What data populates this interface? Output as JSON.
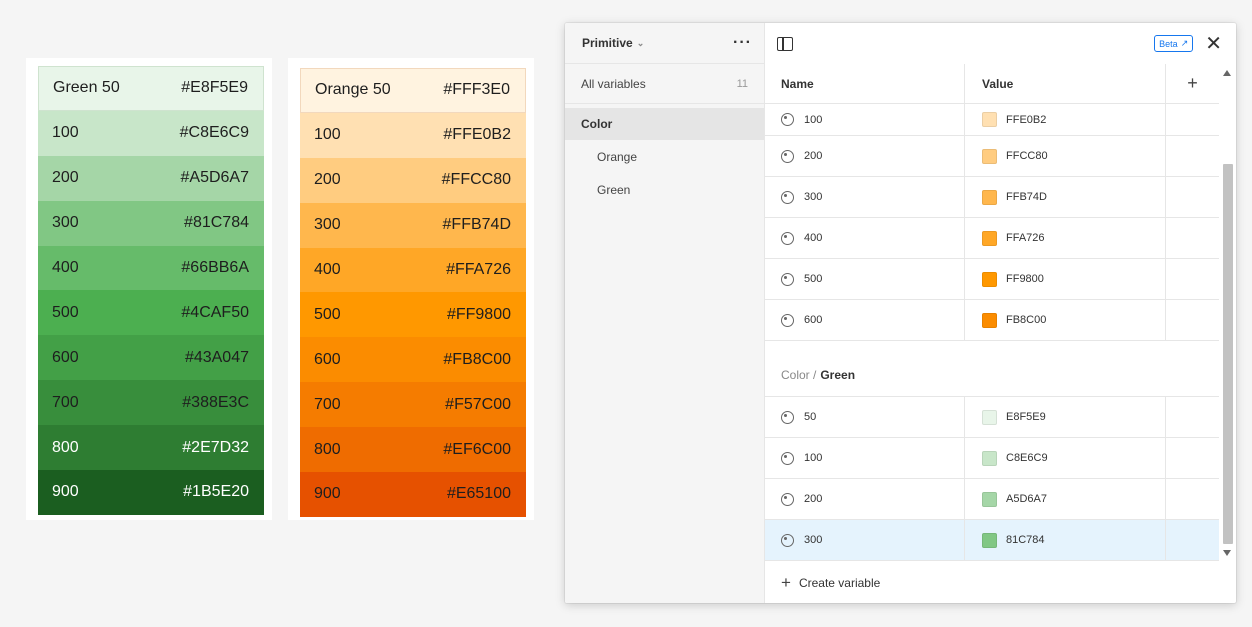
{
  "green_palette": [
    {
      "label": "Green 50",
      "hex": "#E8F5E9",
      "bg": "#E8F5E9",
      "fg": "#1e1e1e"
    },
    {
      "label": "100",
      "hex": "#C8E6C9",
      "bg": "#C8E6C9",
      "fg": "#1e1e1e"
    },
    {
      "label": "200",
      "hex": "#A5D6A7",
      "bg": "#A5D6A7",
      "fg": "#1e1e1e"
    },
    {
      "label": "300",
      "hex": "#81C784",
      "bg": "#81C784",
      "fg": "#1e1e1e"
    },
    {
      "label": "400",
      "hex": "#66BB6A",
      "bg": "#66BB6A",
      "fg": "#1e1e1e"
    },
    {
      "label": "500",
      "hex": "#4CAF50",
      "bg": "#4CAF50",
      "fg": "#1e1e1e"
    },
    {
      "label": "600",
      "hex": "#43A047",
      "bg": "#43A047",
      "fg": "#1e1e1e"
    },
    {
      "label": "700",
      "hex": "#388E3C",
      "bg": "#388E3C",
      "fg": "#1e1e1e"
    },
    {
      "label": "800",
      "hex": "#2E7D32",
      "bg": "#2E7D32",
      "fg": "#ffffff"
    },
    {
      "label": "900",
      "hex": "#1B5E20",
      "bg": "#1B5E20",
      "fg": "#ffffff"
    }
  ],
  "orange_palette": [
    {
      "label": "Orange 50",
      "hex": "#FFF3E0",
      "bg": "#FFF3E0",
      "fg": "#1e1e1e"
    },
    {
      "label": "100",
      "hex": "#FFE0B2",
      "bg": "#FFE0B2",
      "fg": "#1e1e1e"
    },
    {
      "label": "200",
      "hex": "#FFCC80",
      "bg": "#FFCC80",
      "fg": "#1e1e1e"
    },
    {
      "label": "300",
      "hex": "#FFB74D",
      "bg": "#FFB74D",
      "fg": "#1e1e1e"
    },
    {
      "label": "400",
      "hex": "#FFA726",
      "bg": "#FFA726",
      "fg": "#1e1e1e"
    },
    {
      "label": "500",
      "hex": "#FF9800",
      "bg": "#FF9800",
      "fg": "#1e1e1e"
    },
    {
      "label": "600",
      "hex": "#FB8C00",
      "bg": "#FB8C00",
      "fg": "#1e1e1e"
    },
    {
      "label": "700",
      "hex": "#F57C00",
      "bg": "#F57C00",
      "fg": "#1e1e1e"
    },
    {
      "label": "800",
      "hex": "#EF6C00",
      "bg": "#EF6C00",
      "fg": "#1e1e1e"
    },
    {
      "label": "900",
      "hex": "#E65100",
      "bg": "#E65100",
      "fg": "#1e1e1e"
    }
  ],
  "panel": {
    "collection_name": "Primitive",
    "all_variables_label": "All variables",
    "all_variables_count": "11",
    "groups": [
      {
        "label": "Color",
        "type": "parent"
      },
      {
        "label": "Orange",
        "type": "sub"
      },
      {
        "label": "Green",
        "type": "sub"
      }
    ],
    "beta_label": "Beta",
    "columns": {
      "name": "Name",
      "value": "Value"
    },
    "orange_rows": [
      {
        "name": "100",
        "value": "FFE0B2",
        "color": "#FFE0B2"
      },
      {
        "name": "200",
        "value": "FFCC80",
        "color": "#FFCC80"
      },
      {
        "name": "300",
        "value": "FFB74D",
        "color": "#FFB74D"
      },
      {
        "name": "400",
        "value": "FFA726",
        "color": "#FFA726"
      },
      {
        "name": "500",
        "value": "FF9800",
        "color": "#FF9800"
      },
      {
        "name": "600",
        "value": "FB8C00",
        "color": "#FB8C00"
      }
    ],
    "green_heading_prefix": "Color /",
    "green_heading_group": "Green",
    "green_rows": [
      {
        "name": "50",
        "value": "E8F5E9",
        "color": "#E8F5E9"
      },
      {
        "name": "100",
        "value": "C8E6C9",
        "color": "#C8E6C9"
      },
      {
        "name": "200",
        "value": "A5D6A7",
        "color": "#A5D6A7"
      },
      {
        "name": "300",
        "value": "81C784",
        "color": "#81C784",
        "selected": true
      }
    ],
    "create_label": "Create variable"
  }
}
